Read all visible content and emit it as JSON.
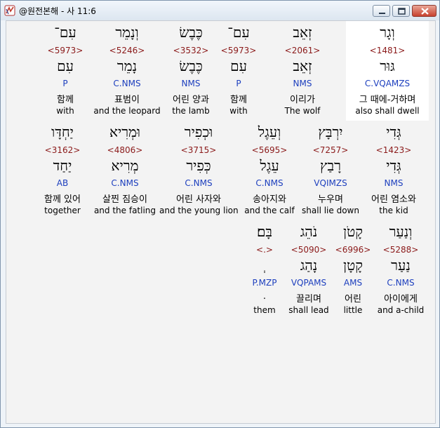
{
  "window": {
    "title": "@원전본해 - 사 11:6"
  },
  "rows": [
    {
      "words": [
        {
          "hebrew": "וְגָר",
          "strong": "<1481>",
          "lemma": "גּוּר",
          "morph": "C.VQAMZS",
          "korean": "그 때에-거하며",
          "english": "also shall dwell",
          "selected": true
        },
        {
          "hebrew": "זְאֵב",
          "strong": "<2061>",
          "lemma": "זְאֵב",
          "morph": "NMS",
          "korean": "이리가",
          "english": "The wolf",
          "selected": false
        },
        {
          "hebrew": "עִם־",
          "strong": "<5973>",
          "lemma": "עִם",
          "morph": "P",
          "korean": "함께",
          "english": "with",
          "selected": false
        },
        {
          "hebrew": "כֶּבֶשׂ",
          "strong": "<3532>",
          "lemma": "כֶּבֶשׂ",
          "morph": "NMS",
          "korean": "어린 양과",
          "english": "the lamb",
          "selected": false
        },
        {
          "hebrew": "וְנָמֵר",
          "strong": "<5246>",
          "lemma": "נָמֵר",
          "morph": "C.NMS",
          "korean": "표범이",
          "english": "and the leopard",
          "selected": false
        },
        {
          "hebrew": "עִם־",
          "strong": "<5973>",
          "lemma": "עִם",
          "morph": "P",
          "korean": "함께",
          "english": "with",
          "selected": false
        }
      ]
    },
    {
      "words": [
        {
          "hebrew": "גְּדִי",
          "strong": "<1423>",
          "lemma": "גְּדִי",
          "morph": "NMS",
          "korean": "어린 염소와",
          "english": "the kid",
          "selected": false
        },
        {
          "hebrew": "יִרְבָּץ",
          "strong": "<7257>",
          "lemma": "רָבַץ",
          "morph": "VQIMZS",
          "korean": "누우며",
          "english": "shall lie down",
          "selected": false
        },
        {
          "hebrew": "וְעֵגֶל",
          "strong": "<5695>",
          "lemma": "עֵגֶל",
          "morph": "C.NMS",
          "korean": "송아지와",
          "english": "and the calf",
          "selected": false
        },
        {
          "hebrew": "וּכְפִיר",
          "strong": "<3715>",
          "lemma": "כְּפִיר",
          "morph": "C.NMS",
          "korean": "어린 사자와",
          "english": "and the young lion",
          "selected": false
        },
        {
          "hebrew": "וּמְרִיא",
          "strong": "<4806>",
          "lemma": "מְרִיא",
          "morph": "C.NMS",
          "korean": "살찐 짐승이",
          "english": "and the fatling",
          "selected": false
        },
        {
          "hebrew": "יַחְדָּו",
          "strong": "<3162>",
          "lemma": "יַחַד",
          "morph": "AB",
          "korean": "함께 있어",
          "english": "together",
          "selected": false
        }
      ]
    },
    {
      "words": [
        {
          "hebrew": "וְנַעַר",
          "strong": "<5288>",
          "lemma": "נַעַר",
          "morph": "C.NMS",
          "korean": "아이에게",
          "english": "and a-child",
          "selected": false
        },
        {
          "hebrew": "קָטֹן",
          "strong": "<6996>",
          "lemma": "קָטָן",
          "morph": "AMS",
          "korean": "어린",
          "english": "little",
          "selected": false
        },
        {
          "hebrew": "נֹהֵג",
          "strong": "<5090>",
          "lemma": "נָהַג",
          "morph": "VQPAMS",
          "korean": "끌리며",
          "english": "shall lead",
          "selected": false
        },
        {
          "hebrew": "בָּם׃",
          "strong": "<.>",
          "lemma": "ְ",
          "morph": "P.MZP",
          "korean": ".",
          "english": "them",
          "selected": false
        }
      ]
    }
  ]
}
